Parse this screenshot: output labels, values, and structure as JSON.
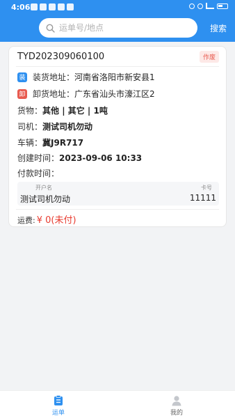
{
  "status_bar": {
    "time": "4:06"
  },
  "search": {
    "placeholder": "运单号/地点",
    "button_label": "搜索"
  },
  "order": {
    "number": "TYD202309060100",
    "status_badge": "作废",
    "load": {
      "tag": "装",
      "label": "装货地址：",
      "value": "河南省洛阳市新安县1"
    },
    "unload": {
      "tag": "卸",
      "label": "卸货地址：",
      "value": "广东省汕头市濠江区2"
    },
    "goods": {
      "label": "货物：",
      "value": "其他 | 其它 | 1吨"
    },
    "driver": {
      "label": "司机：",
      "value": "测试司机勿动"
    },
    "vehicle": {
      "label": "车辆：",
      "value": "冀J9R717"
    },
    "created": {
      "label": "创建时间：",
      "value": "2023-09-06 10:33"
    },
    "payment_time": {
      "label": "付款时间：",
      "value": ""
    },
    "account": {
      "holder_header": "开户名",
      "card_header": "卡号",
      "holder": "测试司机勿动",
      "card": "11111"
    },
    "freight": {
      "label": "运费:",
      "value": "¥ 0(未付)"
    }
  },
  "tabbar": {
    "tabs": [
      {
        "label": "运单",
        "icon": "clipboard-icon",
        "active": true
      },
      {
        "label": "我的",
        "icon": "user-icon",
        "active": false
      }
    ]
  },
  "colors": {
    "primary": "#2e90f0",
    "danger": "#e85a4f",
    "price": "#e83b2f"
  }
}
